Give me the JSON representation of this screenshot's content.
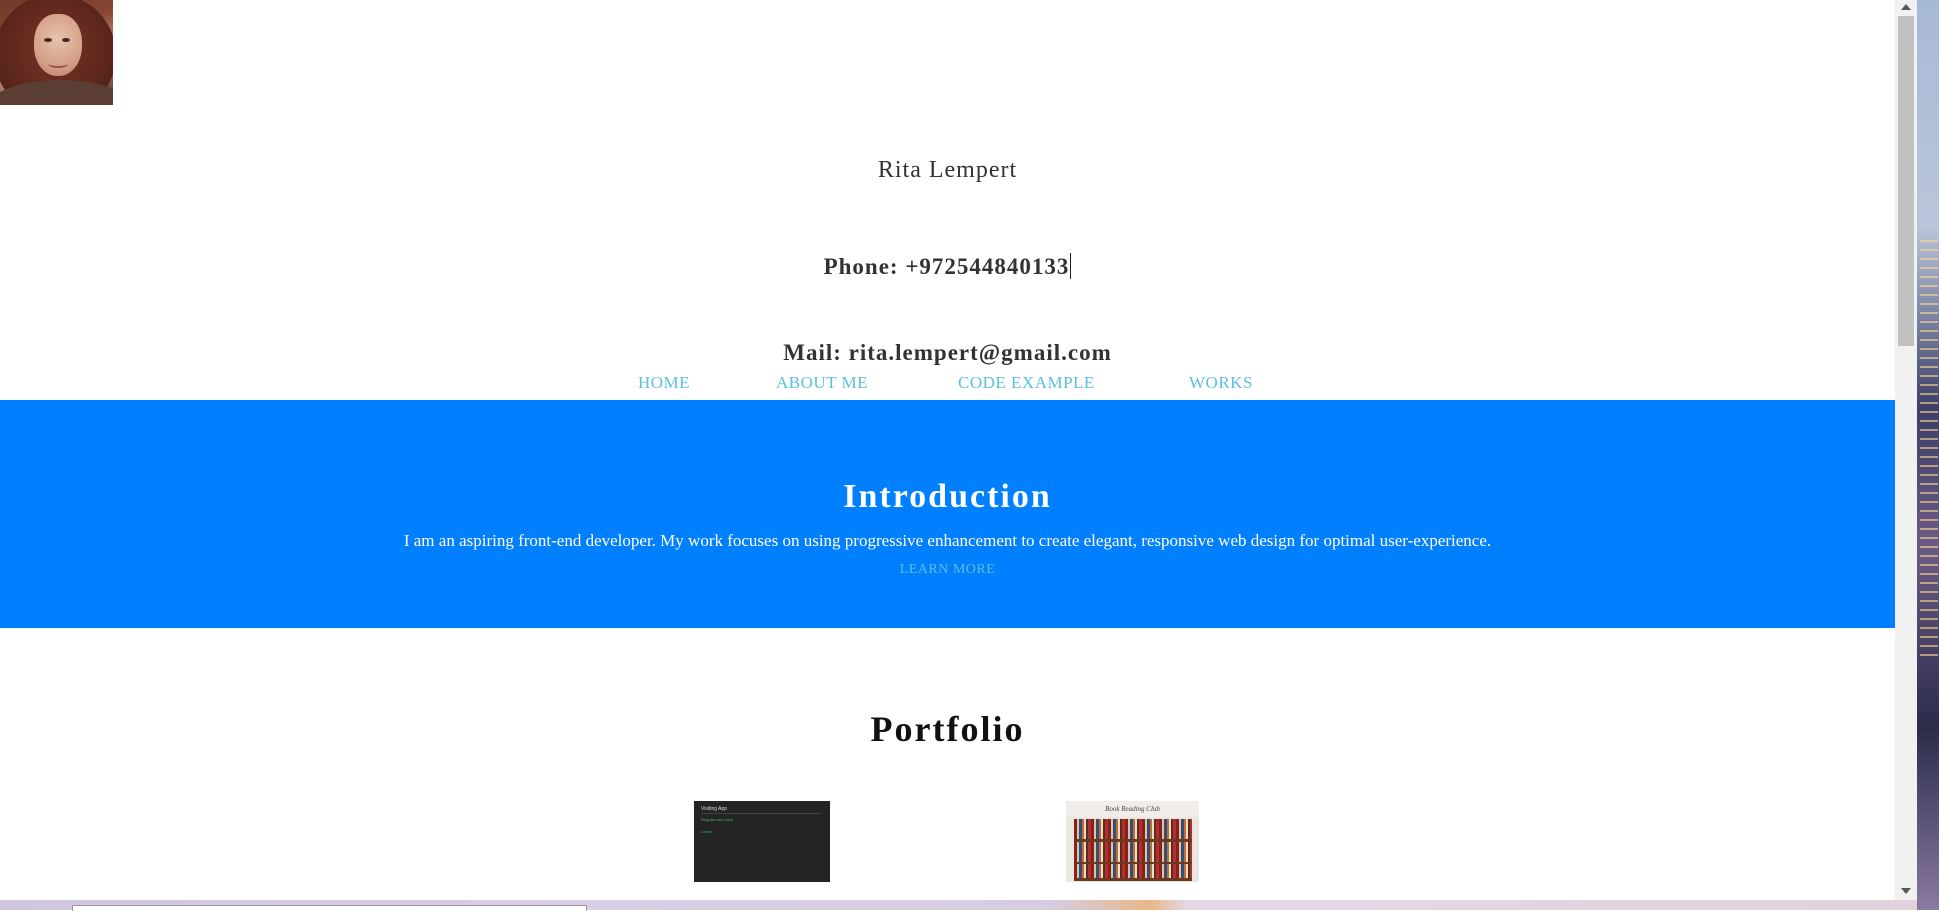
{
  "header": {
    "name": "Rita Lempert",
    "phone": "Phone: +972544840133",
    "mail": "Mail: rita.lempert@gmail.com"
  },
  "nav": {
    "items": [
      {
        "label": "HOME"
      },
      {
        "label": "ABOUT ME"
      },
      {
        "label": "CODE EXAMPLE"
      },
      {
        "label": "WORKS"
      }
    ]
  },
  "intro": {
    "title": "Introduction",
    "text": "I am an aspiring front-end developer. My work focuses on using progressive enhancement to create elegant, responsive web design for optimal user-experience.",
    "link": "LEARN MORE"
  },
  "portfolio": {
    "title": "Portfolio",
    "items": [
      {
        "app_title": "Visiting App",
        "line1": "Regular user view",
        "line2": "Lorem"
      },
      {
        "header": "Book Reading Club"
      }
    ]
  },
  "colors": {
    "accent": "#007fff",
    "link": "#5bc0de"
  }
}
